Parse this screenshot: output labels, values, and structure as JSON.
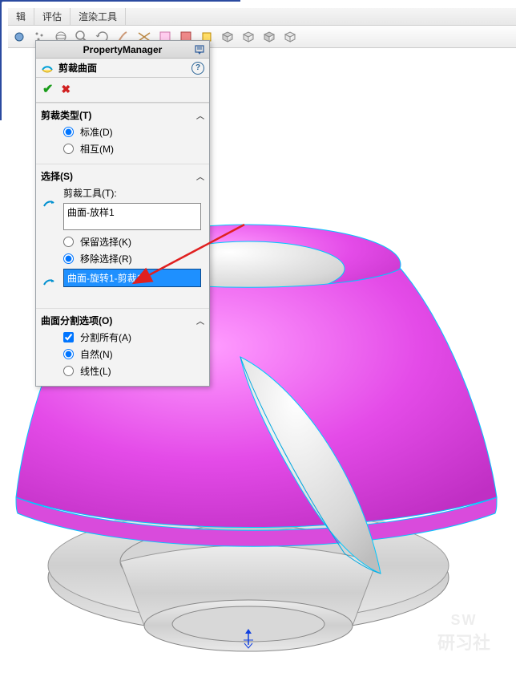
{
  "menubar": {
    "items": [
      "辑",
      "评估",
      "渲染工具"
    ]
  },
  "toolbar": {
    "icons": [
      "spot-icon",
      "dots-icon",
      "sphere-icon",
      "zoom-icon",
      "rotate-icon",
      "brush-icon",
      "cut-icon",
      "sheet-icon",
      "square-icon",
      "sketch-icon",
      "cube-icon",
      "cube2-icon",
      "cube3-icon",
      "cube4-icon"
    ]
  },
  "panel": {
    "title": "PropertyManager",
    "feature_name": "剪裁曲面",
    "sections": {
      "trim_type": {
        "label": "剪裁类型(T)",
        "options": [
          {
            "label": "标准(D)",
            "checked": true
          },
          {
            "label": "相互(M)",
            "checked": false
          }
        ]
      },
      "selection": {
        "label": "选择(S)",
        "tool_label": "剪裁工具(T):",
        "tool_value": "曲面-放样1",
        "keep_remove": [
          {
            "label": "保留选择(K)",
            "checked": false
          },
          {
            "label": "移除选择(R)",
            "checked": true
          }
        ],
        "target_value": "曲面-旋转1-剪裁1"
      },
      "split_options": {
        "label": "曲面分割选项(O)",
        "checkbox": {
          "label": "分割所有(A)",
          "checked": true
        },
        "options": [
          {
            "label": "自然(N)",
            "checked": true
          },
          {
            "label": "线性(L)",
            "checked": false
          }
        ]
      }
    }
  },
  "watermark": {
    "line1": "SW",
    "line2": "研习社"
  }
}
